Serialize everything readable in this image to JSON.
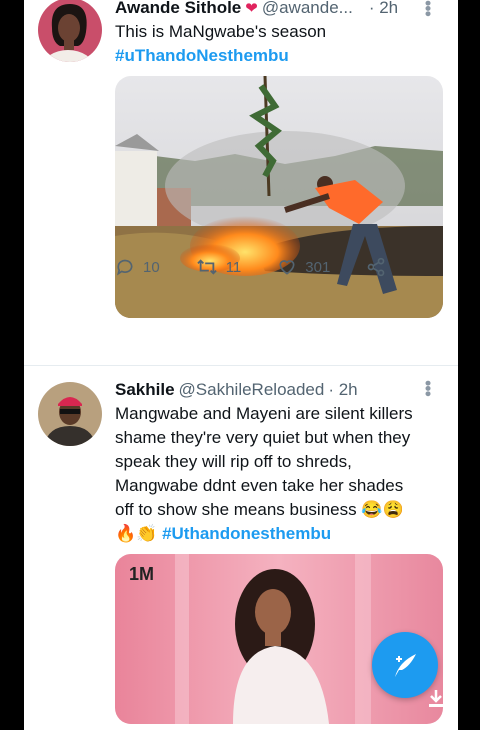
{
  "tweet1": {
    "name": "Awande Sithole",
    "badge": "❤",
    "handle": "@awande...",
    "time": "· 2h",
    "text": "This is MaNgwabe's season",
    "hashtag": "#uThandoNesthembu",
    "replies": "10",
    "retweets": "11",
    "likes": "301"
  },
  "tweet2": {
    "name": "Sakhile",
    "handle": "@SakhileReloaded",
    "time": "· 2h",
    "text_lines": [
      "Mangwabe and Mayeni are silent killers",
      "shame they're very quiet but when they",
      "speak they will rip off to shreds,",
      "Mangwabe ddnt even take her shades",
      "off to show she means business"
    ],
    "emoji_laugh": "😂😩",
    "emoji_row": "🔥👏",
    "hashtag": "#Uthandonesthembu",
    "media_logo": "1M"
  },
  "colors": {
    "accent": "#1d9bf0",
    "text": "#0f1419",
    "muted": "#536471"
  }
}
